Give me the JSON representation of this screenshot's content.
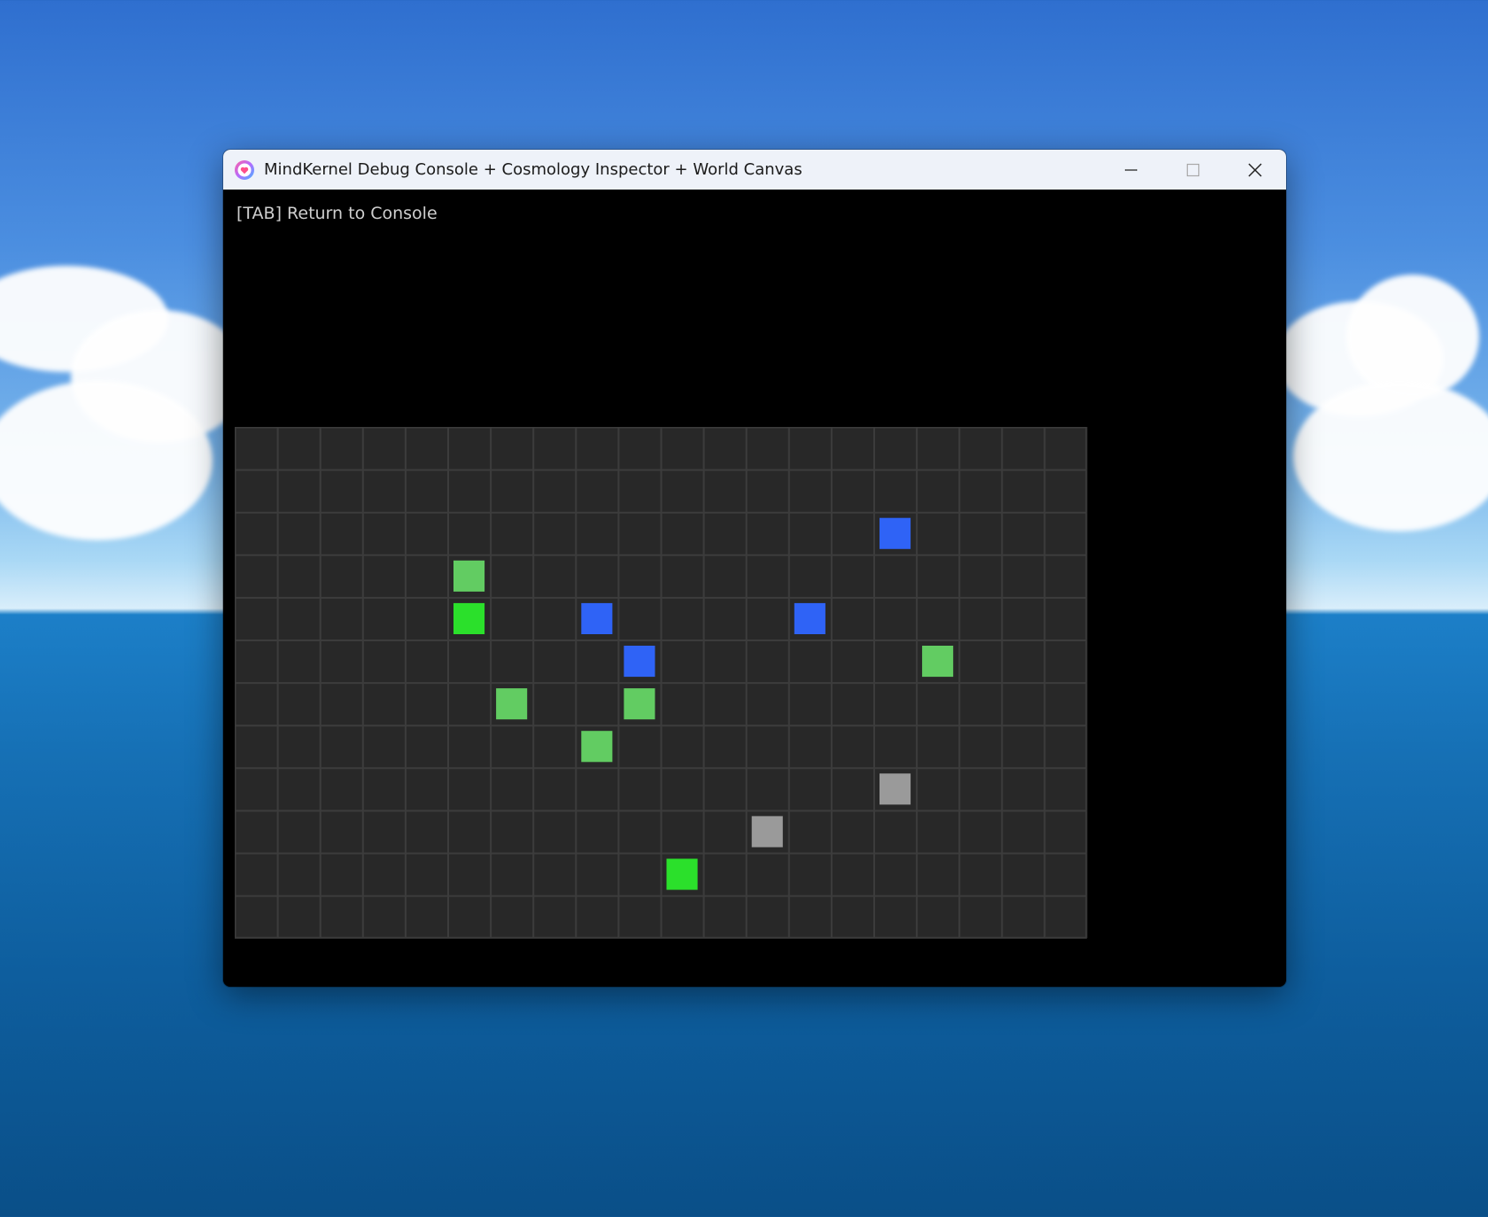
{
  "window": {
    "title": "MindKernel Debug Console + Cosmology Inspector + World Canvas",
    "app_icon": "heart-logo-icon",
    "controls": {
      "minimize_icon": "minimize-icon",
      "maximize_icon": "maximize-icon",
      "close_icon": "close-icon"
    }
  },
  "console": {
    "hint": "[TAB] Return to Console"
  },
  "world": {
    "cols": 20,
    "rows": 12,
    "cell_color": "#282828",
    "grid_line_color": "#3c3c3c",
    "cells": [
      {
        "col": 15,
        "row": 2,
        "kind": "blue",
        "color": "#2f63f6"
      },
      {
        "col": 5,
        "row": 3,
        "kind": "light-green",
        "color": "#62cc62"
      },
      {
        "col": 5,
        "row": 4,
        "kind": "bright-green",
        "color": "#2be02b"
      },
      {
        "col": 8,
        "row": 4,
        "kind": "blue",
        "color": "#2f63f6"
      },
      {
        "col": 13,
        "row": 4,
        "kind": "blue",
        "color": "#2f63f6"
      },
      {
        "col": 9,
        "row": 5,
        "kind": "blue",
        "color": "#2f63f6"
      },
      {
        "col": 16,
        "row": 5,
        "kind": "light-green",
        "color": "#62cc62"
      },
      {
        "col": 6,
        "row": 6,
        "kind": "light-green",
        "color": "#62cc62"
      },
      {
        "col": 9,
        "row": 6,
        "kind": "light-green",
        "color": "#62cc62"
      },
      {
        "col": 8,
        "row": 7,
        "kind": "light-green",
        "color": "#62cc62"
      },
      {
        "col": 15,
        "row": 8,
        "kind": "gray",
        "color": "#9a9a9a"
      },
      {
        "col": 12,
        "row": 9,
        "kind": "gray",
        "color": "#9a9a9a"
      },
      {
        "col": 10,
        "row": 10,
        "kind": "bright-green",
        "color": "#2be02b"
      }
    ]
  }
}
